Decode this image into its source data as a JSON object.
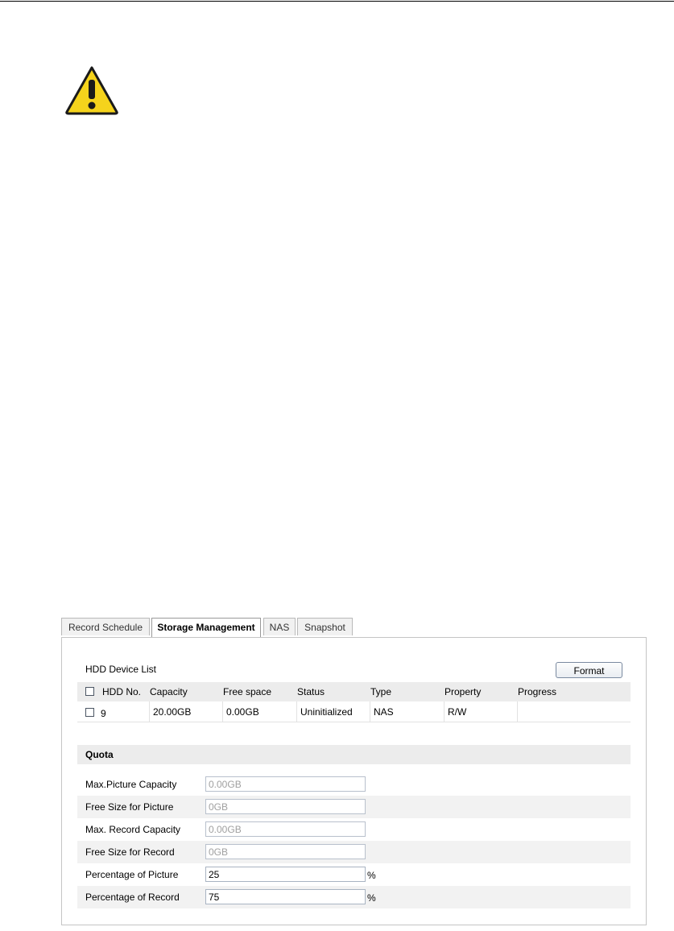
{
  "tabs": [
    {
      "label": "Record Schedule",
      "active": false
    },
    {
      "label": "Storage Management",
      "active": true
    },
    {
      "label": "NAS",
      "active": false
    },
    {
      "label": "Snapshot",
      "active": false
    }
  ],
  "hdd": {
    "section_title": "HDD Device List",
    "format_label": "Format",
    "columns": [
      "HDD No.",
      "Capacity",
      "Free space",
      "Status",
      "Type",
      "Property",
      "Progress"
    ],
    "rows": [
      {
        "hdd_no": "9",
        "capacity": "20.00GB",
        "free_space": "0.00GB",
        "status": "Uninitialized",
        "type": "NAS",
        "property": "R/W",
        "progress": "",
        "checked": false
      }
    ]
  },
  "quota": {
    "section_title": "Quota",
    "fields": [
      {
        "label": "Max.Picture Capacity",
        "value": "0.00GB",
        "disabled": true,
        "unit": ""
      },
      {
        "label": "Free Size for Picture",
        "value": "0GB",
        "disabled": true,
        "unit": ""
      },
      {
        "label": "Max. Record Capacity",
        "value": "0.00GB",
        "disabled": true,
        "unit": ""
      },
      {
        "label": "Free Size for Record",
        "value": "0GB",
        "disabled": true,
        "unit": ""
      },
      {
        "label": "Percentage of Picture",
        "value": "25",
        "disabled": false,
        "unit": "%"
      },
      {
        "label": "Percentage of Record",
        "value": "75",
        "disabled": false,
        "unit": "%"
      }
    ]
  },
  "colors": {
    "warning_fill": "#f5d31c",
    "header_bg": "#ececec"
  },
  "icons": {
    "warning": "warning-triangle-icon"
  }
}
